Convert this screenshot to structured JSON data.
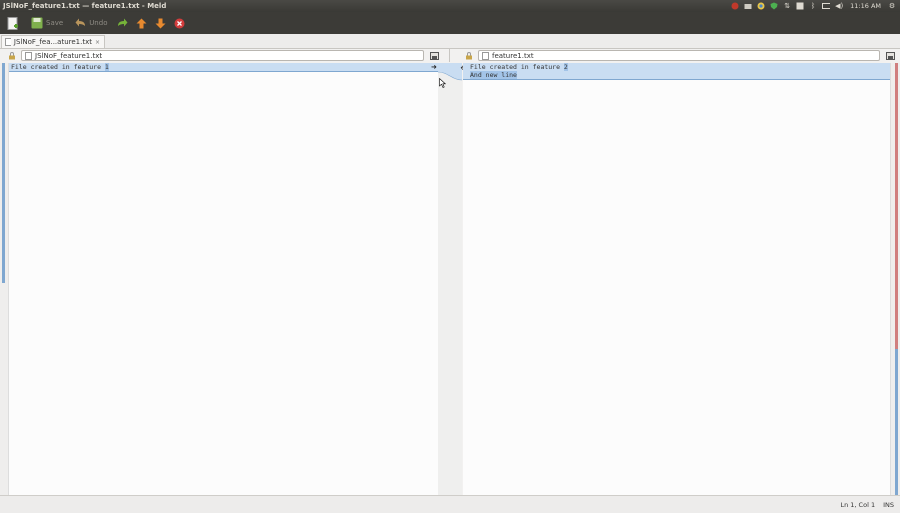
{
  "window": {
    "title": "JSlNoF_feature1.txt — feature1.txt - Meld"
  },
  "tray": {
    "clock": "11:16 AM"
  },
  "toolbar": {
    "save_label": "Save",
    "undo_label": "Undo"
  },
  "tabs": [
    {
      "label": "JSlNoF_fea...ature1.txt"
    }
  ],
  "left": {
    "filename": "JSlNoF_feature1.txt",
    "lines": [
      {
        "prefix": "File created in feature ",
        "highlight": "1",
        "suffix": ""
      }
    ]
  },
  "right": {
    "filename": "feature1.txt",
    "lines": [
      {
        "prefix": "File created in feature ",
        "highlight": "2",
        "suffix": ""
      },
      {
        "prefix": "",
        "highlight": "And new line",
        "suffix": ""
      }
    ]
  },
  "status": {
    "position": "Ln 1, Col 1",
    "mode": "INS"
  },
  "colors": {
    "changed_block": "#c9ddf2",
    "changed_text": "#a3c4e8",
    "map_insert": "#7fa7d0",
    "map_change": "#d07f7f"
  }
}
